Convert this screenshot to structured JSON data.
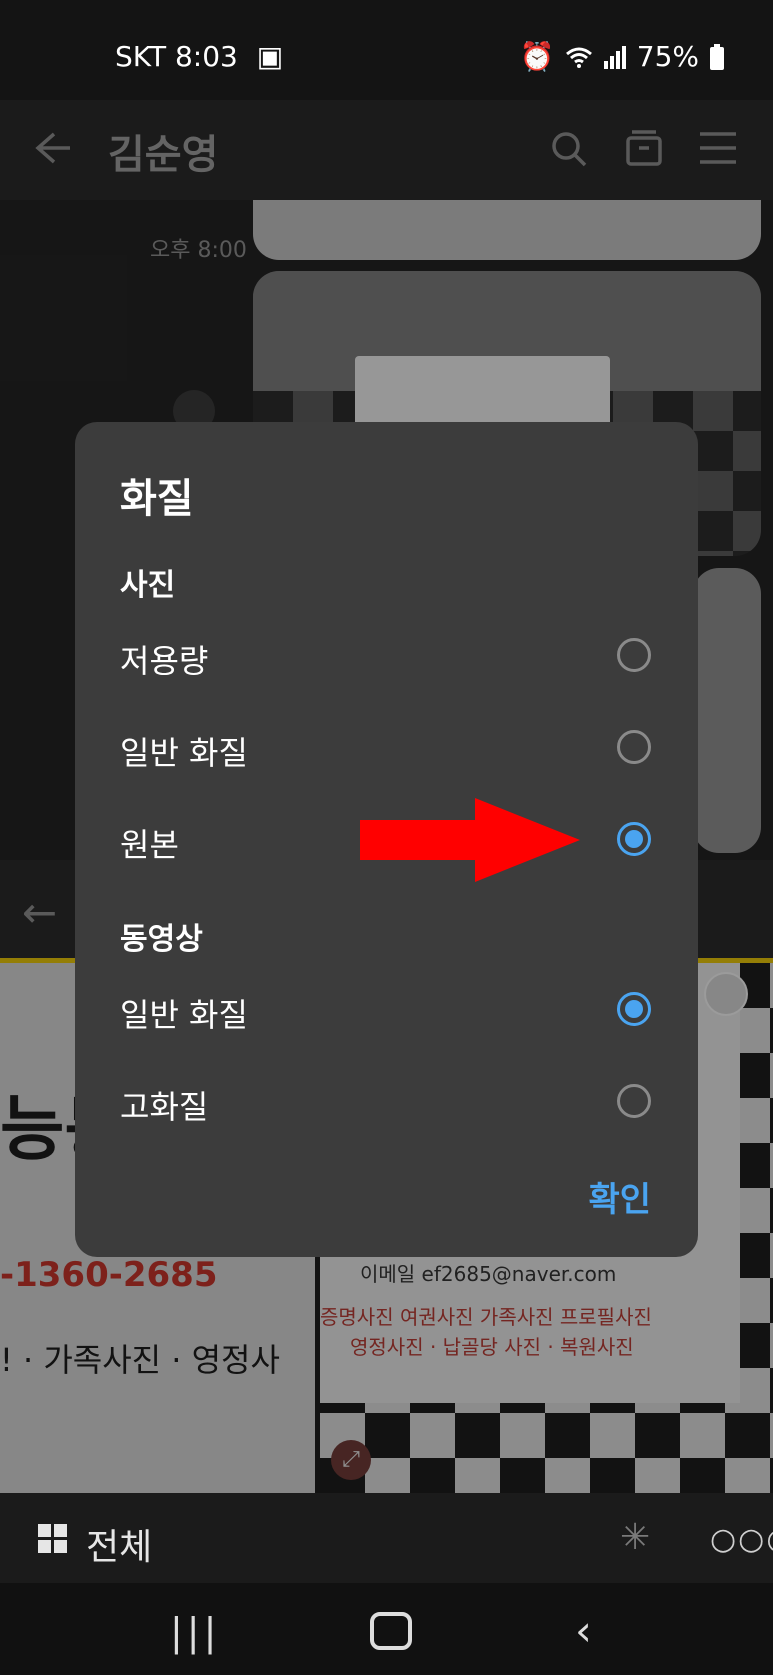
{
  "status_bar": {
    "carrier_time": "SKT 8:03",
    "battery": "75%",
    "icons": [
      "gallery-icon",
      "alarm-icon",
      "wifi-icon",
      "signal-icon",
      "battery-icon"
    ]
  },
  "chat": {
    "title": "김순영",
    "message_time": "오후 8:00"
  },
  "viewer": {
    "left_big_text": "능동",
    "left_phone": "-1360-2685",
    "left_categories": "! · 가족사진 · 영정사",
    "card_email": "이메일  ef2685@naver.com",
    "card_categories_1": "증명사진 여권사진 가족사진 프로필사진",
    "card_categories_2": "영정사진 · 납골당 사진 · 복원사진"
  },
  "bottom_bar": {
    "all_label": "전체"
  },
  "dialog": {
    "title": "화질",
    "photo_section": "사진",
    "photo_options": [
      {
        "label": "저용량",
        "selected": false
      },
      {
        "label": "일반 화질",
        "selected": false
      },
      {
        "label": "원본",
        "selected": true
      }
    ],
    "video_section": "동영상",
    "video_options": [
      {
        "label": "일반 화질",
        "selected": true
      },
      {
        "label": "고화질",
        "selected": false
      }
    ],
    "confirm_label": "확인",
    "accent_color": "#4aa4f0"
  },
  "annotation": {
    "arrow_color": "#ff0000"
  }
}
